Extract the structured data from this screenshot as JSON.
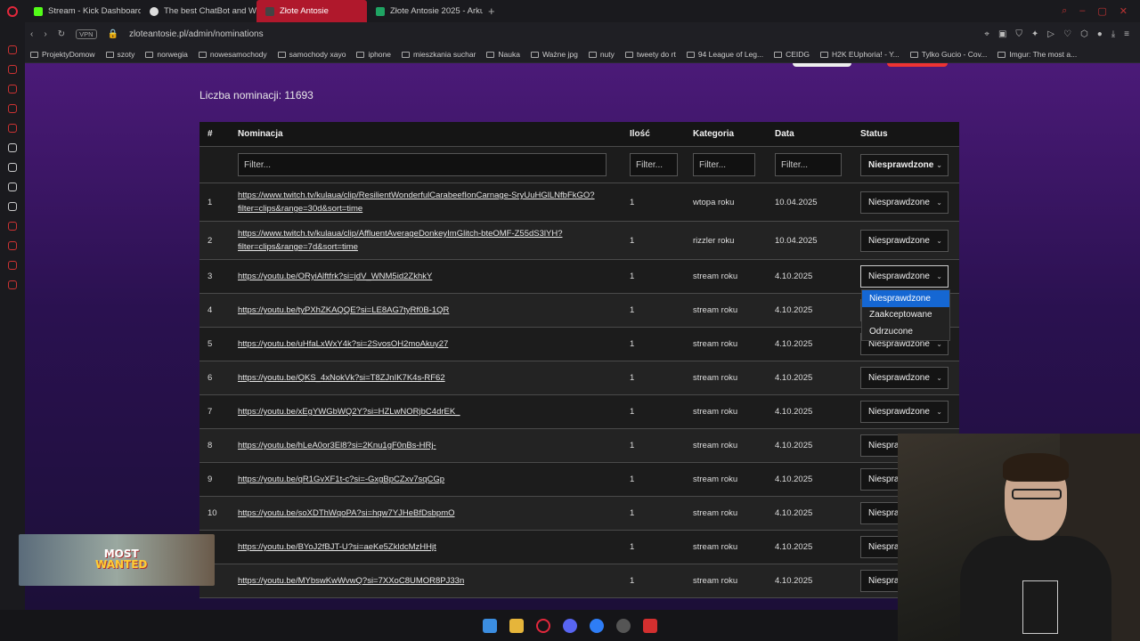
{
  "browser": {
    "tabs": [
      {
        "label": "Stream - Kick Dashboard",
        "color": "#53fc18"
      },
      {
        "label": "The best ChatBot and W",
        "color": "#dddddd"
      },
      {
        "label": "Złote Antosie",
        "color": "#b0182c"
      },
      {
        "label": "Złote Antosie 2025 - Arku",
        "color": "#1fa463"
      }
    ],
    "vpn_label": "VPN",
    "url": "zloteantosie.pl/admin/nominations",
    "bookmarks": [
      "ProjektyDomow",
      "szoty",
      "norwegia",
      "nowesamochody",
      "samochody xayo",
      "iphone",
      "mieszkania suchar",
      "Nauka",
      "Ważne jpg",
      "nuty",
      "tweety do rt",
      "94 League of Leg...",
      "CEIDG",
      "H2K EUphoria! - Y...",
      "Tylko Gucio - Cov...",
      "Imgur: The most a..."
    ]
  },
  "page": {
    "count_label": "Liczba nominacji: 11693",
    "headers": {
      "num": "#",
      "nom": "Nominacja",
      "ilosc": "Ilość",
      "kat": "Kategoria",
      "data": "Data",
      "status": "Status"
    },
    "filter_placeholder": "Filter...",
    "status_filter": "Niesprawdzone",
    "rows": [
      {
        "num": "1",
        "link": "https://www.twitch.tv/kulaua/clip/ResilientWonderfulCarabeefIonCarnage-SryUuHGlLNfbFkGO?filter=clips&range=30d&sort=time",
        "ilosc": "1",
        "kat": "wtopa roku",
        "data": "10.04.2025",
        "status": "Niesprawdzone"
      },
      {
        "num": "2",
        "link": "https://www.twitch.tv/kulaua/clip/AffluentAverageDonkeyImGlitch-bteOMF-Z55dS3lYH?filter=clips&range=7d&sort=time",
        "ilosc": "1",
        "kat": "rizzler roku",
        "data": "10.04.2025",
        "status": "Niesprawdzone"
      },
      {
        "num": "3",
        "link": "https://youtu.be/ORyiAlftfrk?si=jdV_WNM5id2ZkhkY",
        "ilosc": "1",
        "kat": "stream roku",
        "data": "4.10.2025",
        "status": "Niesprawdzone"
      },
      {
        "num": "4",
        "link": "https://youtu.be/tyPXhZKAQQE?si=LE8AG7tyRf0B-1QR",
        "ilosc": "1",
        "kat": "stream roku",
        "data": "4.10.2025",
        "status": "Niesprawdzone"
      },
      {
        "num": "5",
        "link": "https://youtu.be/uHfaLxWxY4k?si=2SvosOH2moAkuy27",
        "ilosc": "1",
        "kat": "stream roku",
        "data": "4.10.2025",
        "status": "Niesprawdzone"
      },
      {
        "num": "6",
        "link": "https://youtu.be/QKS_4xNokVk?si=T8ZJnIK7K4s-RF62",
        "ilosc": "1",
        "kat": "stream roku",
        "data": "4.10.2025",
        "status": "Niesprawdzone"
      },
      {
        "num": "7",
        "link": "https://youtu.be/xEgYWGbWQ2Y?si=HZLwNORjbC4drEK_",
        "ilosc": "1",
        "kat": "stream roku",
        "data": "4.10.2025",
        "status": "Niesprawdzone"
      },
      {
        "num": "8",
        "link": "https://youtu.be/hLeA0or3El8?si=2Knu1gF0nBs-HRj-",
        "ilosc": "1",
        "kat": "stream roku",
        "data": "4.10.2025",
        "status": "Niespra"
      },
      {
        "num": "9",
        "link": "https://youtu.be/qR1GvXF1t-c?si=-GxgBpCZxv7sqCGp",
        "ilosc": "1",
        "kat": "stream roku",
        "data": "4.10.2025",
        "status": "Niespra"
      },
      {
        "num": "10",
        "link": "https://youtu.be/soXDThWqoPA?si=hqw7YJHeBfDsbpmO",
        "ilosc": "1",
        "kat": "stream roku",
        "data": "4.10.2025",
        "status": "Niespra"
      },
      {
        "num": "1",
        "link": "https://youtu.be/BYoJ2fBJT-U?si=aeKe5ZkldcMzHHjt",
        "ilosc": "1",
        "kat": "stream roku",
        "data": "4.10.2025",
        "status": "Niespra"
      },
      {
        "num": "2",
        "link": "https://youtu.be/MYbswKwWvwQ?si=7XXoC8UMOR8PJ33n",
        "ilosc": "1",
        "kat": "stream roku",
        "data": "4.10.2025",
        "status": "Niespra"
      }
    ],
    "dropdown_options": [
      "Niesprawdzone",
      "Zaakceptowane",
      "Odrzucone"
    ]
  },
  "overlay": {
    "game_title_1": "MOST",
    "game_title_2": "WANTED"
  },
  "colors": {
    "accent": "#b0182c",
    "page_purple": "#4b1a78",
    "dropdown_selected": "#1567d3"
  }
}
